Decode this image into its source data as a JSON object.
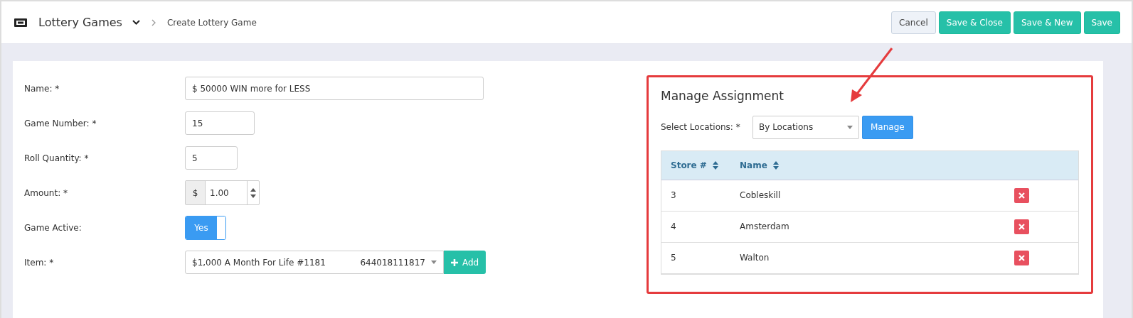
{
  "header": {
    "title": "Lottery Games",
    "breadcrumb": "Create Lottery Game",
    "buttons": [
      {
        "label": "Cancel",
        "kind": "secondary"
      },
      {
        "label": "Save & Close",
        "kind": "primary"
      },
      {
        "label": "Save & New",
        "kind": "primary"
      },
      {
        "label": "Save",
        "kind": "primary"
      }
    ]
  },
  "form": {
    "fields": [
      {
        "kind": "text",
        "label": "Name: *",
        "value": "$ 50000 WIN more for LESS"
      },
      {
        "kind": "text",
        "label": "Game Number: *",
        "value": "15"
      },
      {
        "kind": "text",
        "label": "Roll Quantity: *",
        "value": "5"
      },
      {
        "kind": "money",
        "label": "Amount: *",
        "prefix": "$",
        "value": "1.00"
      },
      {
        "kind": "toggle",
        "label": "Game Active:",
        "on": true,
        "on_label": "Yes"
      },
      {
        "kind": "item",
        "label": "Item: *",
        "value": "$1,000 A Month For Life #1181",
        "code": "644018111817",
        "button": "Add"
      }
    ]
  },
  "assignment": {
    "title": "Manage Assignment",
    "select_label": "Select Locations: *",
    "select_value": "By Locations",
    "manage_button": "Manage",
    "columns": [
      "Store #",
      "Name"
    ],
    "rows": [
      {
        "store": "3",
        "name": "Cobleskill"
      },
      {
        "store": "4",
        "name": "Amsterdam"
      },
      {
        "store": "5",
        "name": "Walton"
      }
    ]
  }
}
